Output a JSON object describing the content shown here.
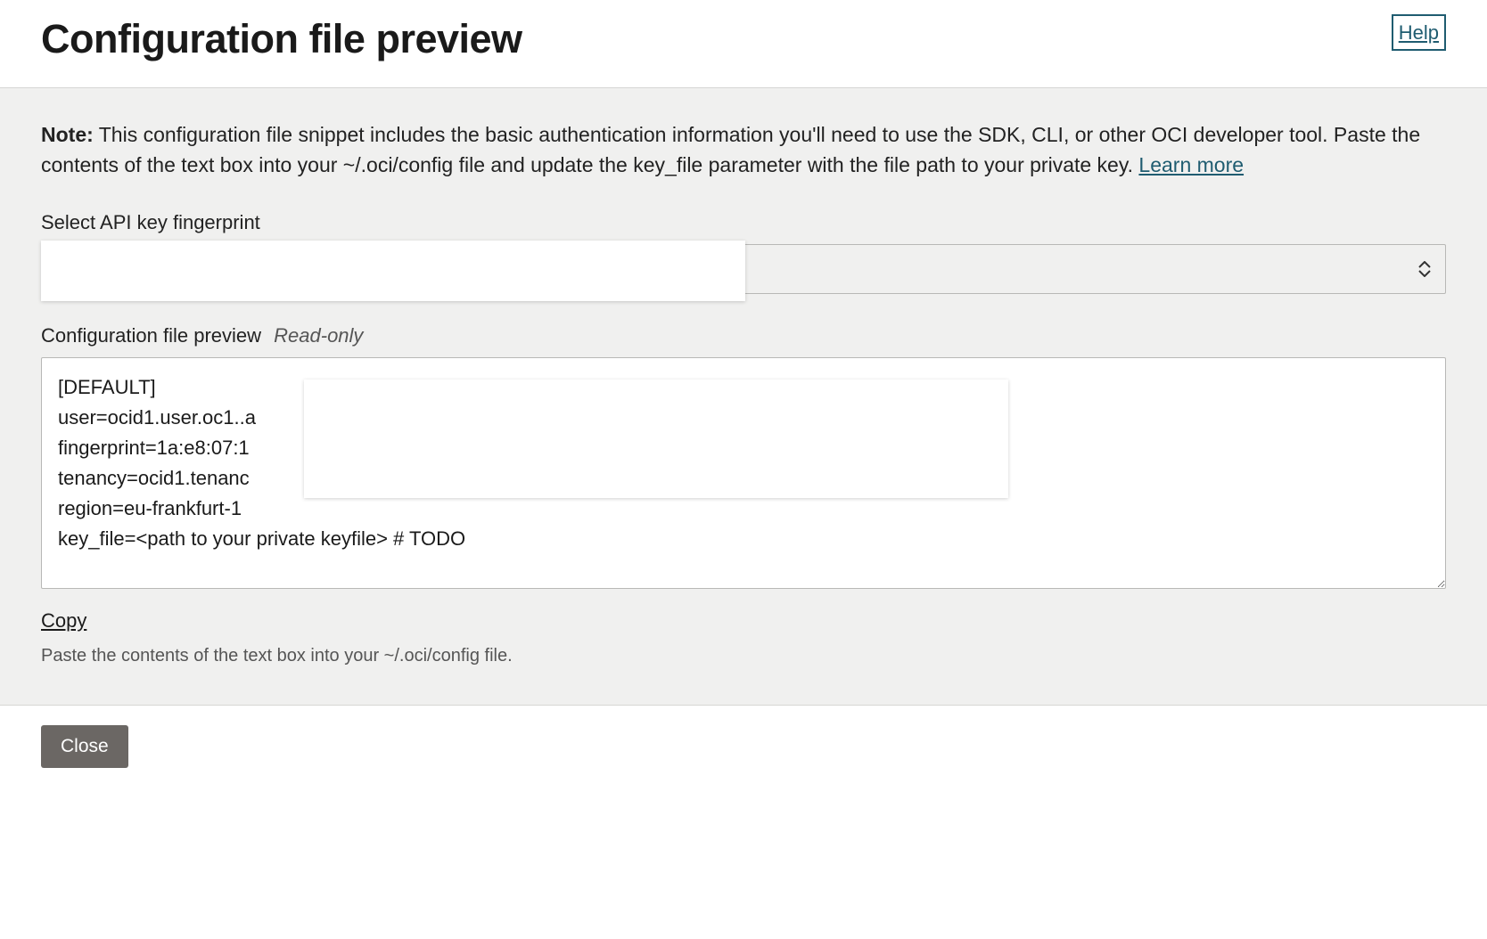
{
  "header": {
    "title": "Configuration file preview",
    "help_label": "Help"
  },
  "note": {
    "prefix": "Note:",
    "text": " This configuration file snippet includes the basic authentication information you'll need to use the SDK, CLI, or other OCI developer tool. Paste the contents of the text box into your ~/.oci/config file and update the key_file parameter with the file path to your private key. ",
    "learn_more": "Learn more"
  },
  "fingerprint": {
    "label": "Select API key fingerprint",
    "value": ""
  },
  "preview": {
    "label": "Configuration file preview",
    "readonly_label": "Read-only",
    "content": "[DEFAULT]\nuser=ocid1.user.oc1..a\nfingerprint=1a:e8:07:1\ntenancy=ocid1.tenanc\nregion=eu-frankfurt-1\nkey_file=<path to your private keyfile> # TODO"
  },
  "copy_label": "Copy",
  "paste_hint": "Paste the contents of the text box into your ~/.oci/config file.",
  "footer": {
    "close_label": "Close"
  }
}
